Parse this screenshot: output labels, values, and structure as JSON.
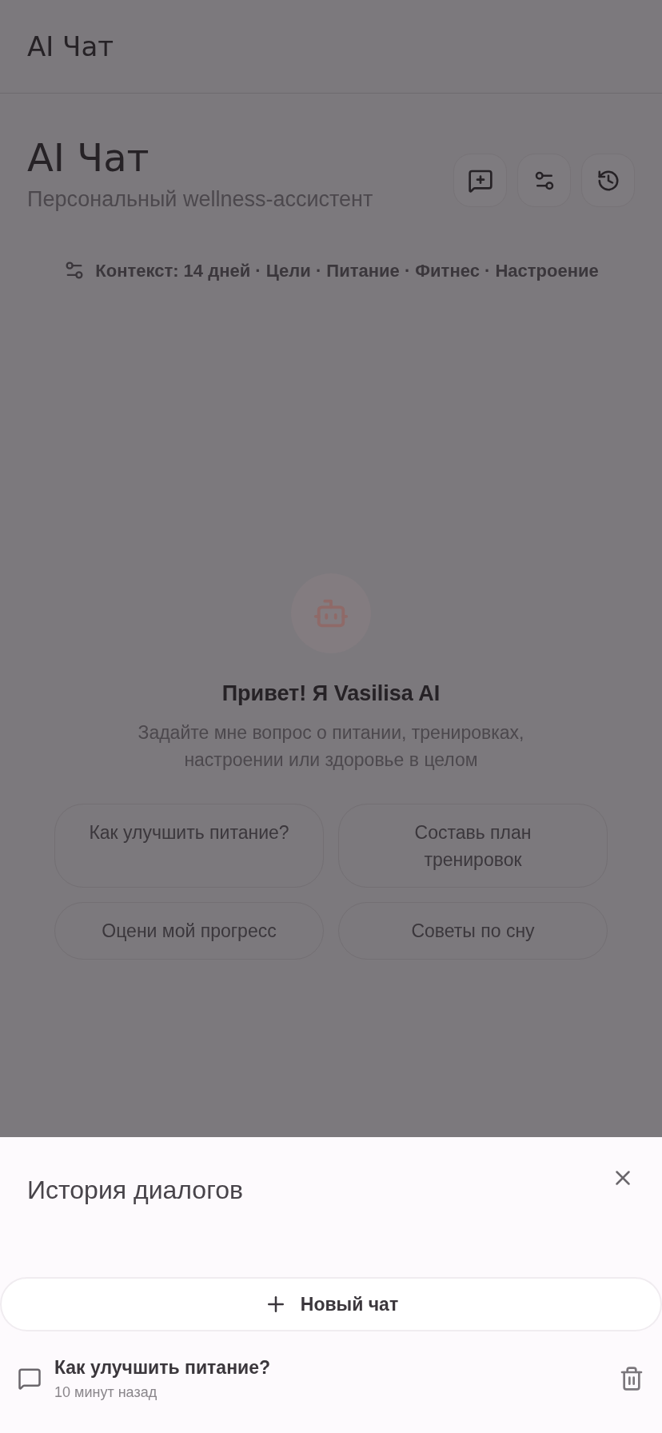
{
  "app_bar": {
    "title": "AI Чат"
  },
  "header": {
    "title": "AI Чат",
    "subtitle": "Персональный wellness-ассистент"
  },
  "context": {
    "text": "Контекст: 14 дней · Цели · Питание · Фитнес · Настроение"
  },
  "welcome": {
    "title": "Привет! Я Vasilisa AI",
    "text": "Задайте мне вопрос о питании, тренировках, настроении или здоровье в целом"
  },
  "suggestions": [
    "Как улучшить питание?",
    "Составь план тренировок",
    "Оцени мой прогресс",
    "Советы по сну"
  ],
  "history_sheet": {
    "title": "История диалогов",
    "new_chat": "Новый чат",
    "items": [
      {
        "title": "Как улучшить питание?",
        "time": "10 минут назад"
      }
    ]
  }
}
